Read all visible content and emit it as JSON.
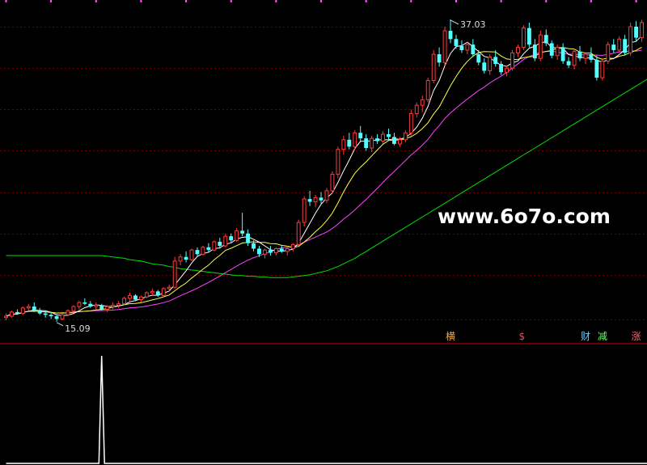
{
  "watermark": "www.6o7o.com",
  "colors": {
    "background": "#000000",
    "grid": "#7a0000",
    "up": "#ff3b3b",
    "down": "#54ffff",
    "ma5": "#ffffff",
    "ma10": "#ffff44",
    "ma20": "#ff44ff",
    "ma60": "#00e000",
    "divider": "#cc0000",
    "indicator": "#ffffff",
    "annotation": "#dddddd",
    "marker_top": "#ff55ff"
  },
  "chart_data": [
    {
      "type": "candlestick",
      "price_annotations": {
        "high": "37.03",
        "low": "15.09"
      },
      "y_range": [
        13.8,
        38.2
      ],
      "grid": true,
      "gridlines": [
        15.25,
        18.5,
        21.5,
        24.5,
        27.5,
        30.5,
        33.5,
        36.5
      ],
      "signal_labels": [
        {
          "text": "横",
          "color": "#ffaa33",
          "index": 79
        },
        {
          "text": "$",
          "color": "#ff4444",
          "index": 92
        },
        {
          "text": "财",
          "color": "#66ccff",
          "index": 103
        },
        {
          "text": "减",
          "color": "#66ff66",
          "index": 106
        },
        {
          "text": "涨",
          "color": "#ff6666",
          "index": 112
        }
      ],
      "ohlc": [
        [
          15.4,
          15.7,
          15.2,
          15.5
        ],
        [
          15.5,
          15.9,
          15.4,
          15.8
        ],
        [
          15.8,
          16.0,
          15.6,
          15.7
        ],
        [
          15.7,
          16.2,
          15.6,
          16.1
        ],
        [
          16.1,
          16.4,
          15.9,
          16.2
        ],
        [
          16.2,
          16.5,
          15.8,
          15.9
        ],
        [
          15.9,
          16.1,
          15.6,
          15.7
        ],
        [
          15.7,
          15.9,
          15.4,
          15.6
        ],
        [
          15.6,
          15.8,
          15.3,
          15.5
        ],
        [
          15.5,
          15.6,
          15.1,
          15.3
        ],
        [
          15.3,
          15.7,
          15.2,
          15.6
        ],
        [
          15.6,
          16.0,
          15.5,
          15.9
        ],
        [
          15.9,
          16.3,
          15.8,
          16.2
        ],
        [
          16.2,
          16.6,
          16.0,
          16.5
        ],
        [
          16.5,
          16.8,
          16.3,
          16.4
        ],
        [
          16.4,
          16.6,
          16.1,
          16.2
        ],
        [
          16.2,
          16.5,
          16.0,
          16.3
        ],
        [
          16.3,
          16.4,
          15.9,
          16.0
        ],
        [
          16.0,
          16.3,
          15.8,
          16.2
        ],
        [
          16.2,
          16.5,
          16.0,
          16.3
        ],
        [
          16.3,
          16.6,
          16.1,
          16.4
        ],
        [
          16.4,
          16.9,
          16.3,
          16.8
        ],
        [
          16.8,
          17.2,
          16.6,
          17.0
        ],
        [
          17.0,
          17.1,
          16.6,
          16.7
        ],
        [
          16.7,
          17.0,
          16.5,
          16.9
        ],
        [
          16.9,
          17.3,
          16.8,
          17.2
        ],
        [
          17.2,
          17.5,
          17.0,
          17.3
        ],
        [
          17.3,
          17.4,
          16.9,
          17.0
        ],
        [
          17.0,
          17.6,
          16.9,
          17.5
        ],
        [
          17.5,
          17.8,
          17.3,
          17.6
        ],
        [
          17.6,
          19.8,
          17.5,
          19.5
        ],
        [
          19.5,
          20.0,
          19.2,
          19.8
        ],
        [
          19.8,
          20.2,
          19.4,
          19.6
        ],
        [
          19.6,
          20.4,
          19.5,
          20.3
        ],
        [
          20.3,
          20.5,
          19.8,
          20.0
        ],
        [
          20.0,
          20.6,
          19.9,
          20.5
        ],
        [
          20.5,
          20.8,
          20.1,
          20.3
        ],
        [
          20.3,
          21.0,
          20.2,
          20.9
        ],
        [
          20.9,
          21.2,
          20.4,
          20.6
        ],
        [
          20.6,
          21.5,
          20.5,
          21.3
        ],
        [
          21.3,
          21.5,
          20.8,
          21.0
        ],
        [
          21.0,
          21.9,
          20.9,
          21.7
        ],
        [
          21.7,
          23.0,
          21.3,
          21.5
        ],
        [
          21.5,
          21.8,
          20.6,
          20.8
        ],
        [
          20.8,
          21.0,
          20.2,
          20.4
        ],
        [
          20.4,
          20.6,
          19.8,
          20.0
        ],
        [
          20.0,
          20.4,
          19.7,
          20.3
        ],
        [
          20.3,
          20.6,
          19.9,
          20.1
        ],
        [
          20.1,
          20.5,
          19.9,
          20.4
        ],
        [
          20.4,
          20.6,
          20.1,
          20.2
        ],
        [
          20.2,
          20.6,
          19.9,
          20.4
        ],
        [
          20.4,
          20.8,
          20.2,
          20.7
        ],
        [
          20.7,
          22.5,
          20.6,
          22.3
        ],
        [
          22.3,
          24.2,
          22.0,
          24.0
        ],
        [
          24.0,
          24.6,
          23.5,
          23.8
        ],
        [
          23.8,
          24.3,
          23.4,
          24.1
        ],
        [
          24.1,
          24.5,
          23.6,
          23.9
        ],
        [
          23.9,
          24.8,
          23.7,
          24.6
        ],
        [
          24.6,
          26.0,
          24.4,
          25.8
        ],
        [
          25.8,
          27.8,
          25.5,
          27.6
        ],
        [
          27.6,
          28.6,
          27.2,
          28.3
        ],
        [
          28.3,
          28.8,
          27.6,
          27.8
        ],
        [
          27.8,
          29.0,
          27.6,
          28.8
        ],
        [
          28.8,
          29.3,
          28.2,
          28.4
        ],
        [
          28.4,
          28.7,
          27.5,
          27.7
        ],
        [
          27.7,
          28.6,
          27.4,
          28.4
        ],
        [
          28.4,
          28.7,
          28.0,
          28.2
        ],
        [
          28.2,
          28.9,
          28.0,
          28.7
        ],
        [
          28.7,
          29.1,
          28.3,
          28.5
        ],
        [
          28.5,
          28.8,
          27.9,
          28.0
        ],
        [
          28.0,
          28.5,
          27.8,
          28.3
        ],
        [
          28.3,
          29.0,
          28.1,
          28.8
        ],
        [
          28.8,
          30.5,
          28.6,
          30.2
        ],
        [
          30.2,
          31.0,
          29.9,
          30.8
        ],
        [
          30.8,
          31.5,
          30.3,
          31.2
        ],
        [
          31.2,
          32.8,
          31.0,
          32.6
        ],
        [
          32.6,
          34.8,
          32.4,
          34.5
        ],
        [
          34.5,
          35.0,
          33.6,
          33.9
        ],
        [
          33.9,
          36.5,
          33.7,
          36.2
        ],
        [
          36.2,
          37.03,
          35.3,
          35.6
        ],
        [
          35.6,
          35.9,
          34.9,
          35.1
        ],
        [
          35.1,
          35.5,
          34.6,
          34.8
        ],
        [
          34.8,
          35.4,
          34.5,
          35.2
        ],
        [
          35.2,
          35.6,
          34.3,
          34.5
        ],
        [
          34.5,
          34.8,
          33.7,
          33.9
        ],
        [
          33.9,
          34.2,
          33.1,
          33.3
        ],
        [
          33.3,
          34.5,
          33.0,
          34.3
        ],
        [
          34.3,
          34.8,
          33.6,
          33.8
        ],
        [
          33.8,
          34.0,
          33.0,
          33.2
        ],
        [
          33.2,
          33.7,
          32.9,
          33.5
        ],
        [
          33.5,
          34.8,
          33.3,
          34.6
        ],
        [
          34.6,
          35.2,
          34.3,
          35.0
        ],
        [
          35.0,
          36.6,
          34.8,
          36.4
        ],
        [
          36.4,
          36.8,
          35.0,
          35.2
        ],
        [
          35.2,
          35.6,
          34.0,
          34.2
        ],
        [
          34.2,
          36.2,
          34.0,
          35.9
        ],
        [
          35.9,
          36.3,
          35.1,
          35.3
        ],
        [
          35.3,
          35.5,
          34.2,
          34.4
        ],
        [
          34.4,
          35.2,
          34.1,
          35.0
        ],
        [
          35.0,
          35.3,
          33.8,
          34.0
        ],
        [
          34.0,
          34.3,
          33.5,
          33.7
        ],
        [
          33.7,
          34.9,
          33.4,
          34.7
        ],
        [
          34.7,
          35.1,
          34.0,
          34.2
        ],
        [
          34.2,
          34.6,
          33.8,
          34.5
        ],
        [
          34.5,
          35.0,
          33.9,
          34.1
        ],
        [
          34.1,
          34.4,
          32.6,
          32.8
        ],
        [
          32.8,
          34.2,
          32.6,
          34.0
        ],
        [
          34.0,
          35.4,
          33.8,
          35.2
        ],
        [
          35.2,
          35.6,
          34.6,
          34.8
        ],
        [
          34.8,
          35.8,
          34.6,
          35.6
        ],
        [
          35.6,
          35.9,
          34.4,
          34.6
        ],
        [
          34.6,
          36.8,
          34.4,
          36.5
        ],
        [
          36.5,
          36.9,
          35.4,
          35.7
        ],
        [
          35.7,
          37.0,
          35.4,
          36.8
        ]
      ],
      "ma60": [
        19.9,
        19.9,
        19.9,
        19.9,
        19.9,
        19.9,
        19.9,
        19.9,
        19.9,
        19.9,
        19.9,
        19.9,
        19.9,
        19.9,
        19.9,
        19.9,
        19.9,
        19.9,
        19.85,
        19.8,
        19.75,
        19.7,
        19.6,
        19.55,
        19.5,
        19.4,
        19.3,
        19.25,
        19.2,
        19.1,
        19.05,
        18.95,
        18.9,
        18.85,
        18.8,
        18.75,
        18.7,
        18.65,
        18.6,
        18.55,
        18.5,
        18.45,
        18.45,
        18.4,
        18.4,
        18.35,
        18.35,
        18.3,
        18.3,
        18.3,
        18.3,
        18.35,
        18.4,
        18.45,
        18.5,
        18.6,
        18.7,
        18.8,
        18.95,
        19.1,
        19.3,
        19.5,
        19.7,
        19.95,
        20.2,
        20.45,
        20.7,
        20.95,
        21.2,
        21.45,
        21.7,
        21.95,
        22.2,
        22.45,
        22.7,
        22.95,
        23.2,
        23.45,
        23.7,
        23.95,
        24.2,
        24.45,
        24.7,
        24.95,
        25.2,
        25.45,
        25.7,
        25.95,
        26.2,
        26.45,
        26.7,
        26.95,
        27.2,
        27.45,
        27.7,
        27.95,
        28.2,
        28.45,
        28.7,
        28.95,
        29.2,
        29.45,
        29.7,
        29.95,
        30.2,
        30.45,
        30.7,
        30.95,
        31.2,
        31.45,
        31.7,
        31.95,
        32.2,
        32.45,
        32.7
      ],
      "indicator": {
        "type": "line",
        "y_range": [
          0,
          1
        ],
        "values": [
          0,
          0,
          0,
          0,
          0,
          0,
          0,
          0,
          0,
          0,
          0,
          0,
          0,
          0,
          0,
          0,
          0,
          0,
          0,
          0,
          0,
          0,
          0,
          0,
          0,
          0,
          0,
          0,
          0,
          0,
          0,
          0,
          0,
          0,
          0,
          0,
          0,
          0,
          0,
          0,
          0,
          0,
          0,
          0,
          0,
          0,
          0,
          0,
          0,
          0,
          0,
          0,
          0,
          0,
          0,
          0,
          0,
          0,
          0,
          0,
          0,
          0,
          0,
          0,
          0,
          0,
          0,
          0,
          0,
          0,
          0,
          0,
          0,
          0,
          0,
          0,
          0,
          0,
          0,
          0,
          0,
          0,
          0,
          0,
          0,
          0,
          0,
          0,
          0,
          0,
          0,
          0,
          0,
          0,
          0,
          0,
          0,
          0,
          0,
          0,
          0,
          0,
          0,
          0,
          0,
          0,
          0,
          0,
          0,
          0,
          0,
          0,
          0,
          0,
          0
        ],
        "spike_index": 17,
        "spike_value": 1
      }
    }
  ]
}
